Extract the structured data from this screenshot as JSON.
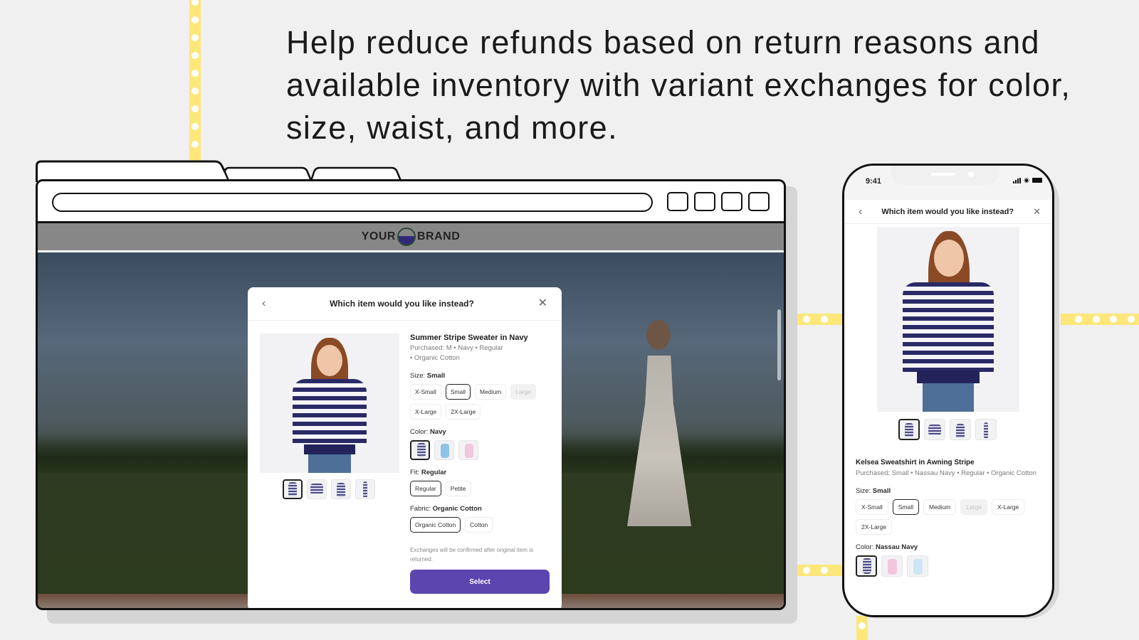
{
  "headline": "Help reduce refunds based on return reasons and available inventory with variant exchanges for color, size, waist, and more.",
  "colors": {
    "accent_yellow": "#fde77a",
    "select_button": "#5b46b0",
    "brand_logo_bottom": "#2f2a78"
  },
  "desktop": {
    "brand": {
      "left": "YOUR",
      "right": "BRAND"
    },
    "modal": {
      "title": "Which item would you like instead?",
      "back_icon": "chevron-left-icon",
      "close_icon": "close-icon",
      "product_name": "Summer Stripe Sweater in Navy",
      "purchased_line1": "Purchased: M • Navy • Regular",
      "purchased_line2": "• Organic Cotton",
      "size": {
        "label": "Size:",
        "value": "Small",
        "options": [
          {
            "label": "X-Small",
            "state": "default"
          },
          {
            "label": "Small",
            "state": "selected"
          },
          {
            "label": "Medium",
            "state": "default"
          },
          {
            "label": "Large",
            "state": "disabled"
          },
          {
            "label": "X-Large",
            "state": "default"
          },
          {
            "label": "2X-Large",
            "state": "default"
          }
        ]
      },
      "color": {
        "label": "Color:",
        "value": "Navy",
        "swatches": [
          "navy-stripe",
          "light-blue",
          "pink"
        ]
      },
      "fit": {
        "label": "Fit:",
        "value": "Regular",
        "options": [
          {
            "label": "Regular",
            "state": "selected"
          },
          {
            "label": "Petite",
            "state": "default"
          }
        ]
      },
      "fabric": {
        "label": "Fabric:",
        "value": "Organic Cotton",
        "options": [
          {
            "label": "Organic Cotton",
            "state": "selected"
          },
          {
            "label": "Cotton",
            "state": "default"
          }
        ]
      },
      "note": "Exchanges will be confirmed after original item is returned.",
      "select_label": "Select"
    }
  },
  "phone": {
    "time": "9:41",
    "title": "Which item would you like instead?",
    "product_name": "Kelsea Sweatshirt in Awning Stripe",
    "purchased": "Purchased: Small • Nassau Navy • Regular • Organic Cotton",
    "size": {
      "label": "Size:",
      "value": "Small",
      "options": [
        {
          "label": "X-Small",
          "state": "default"
        },
        {
          "label": "Small",
          "state": "selected"
        },
        {
          "label": "Medium",
          "state": "default"
        },
        {
          "label": "Large",
          "state": "disabled"
        },
        {
          "label": "X-Large",
          "state": "default"
        },
        {
          "label": "2X-Large",
          "state": "default"
        }
      ]
    },
    "color": {
      "label": "Color:",
      "value": "Nassau Navy",
      "swatches": [
        "navy-stripe",
        "pink",
        "light-blue"
      ]
    }
  }
}
